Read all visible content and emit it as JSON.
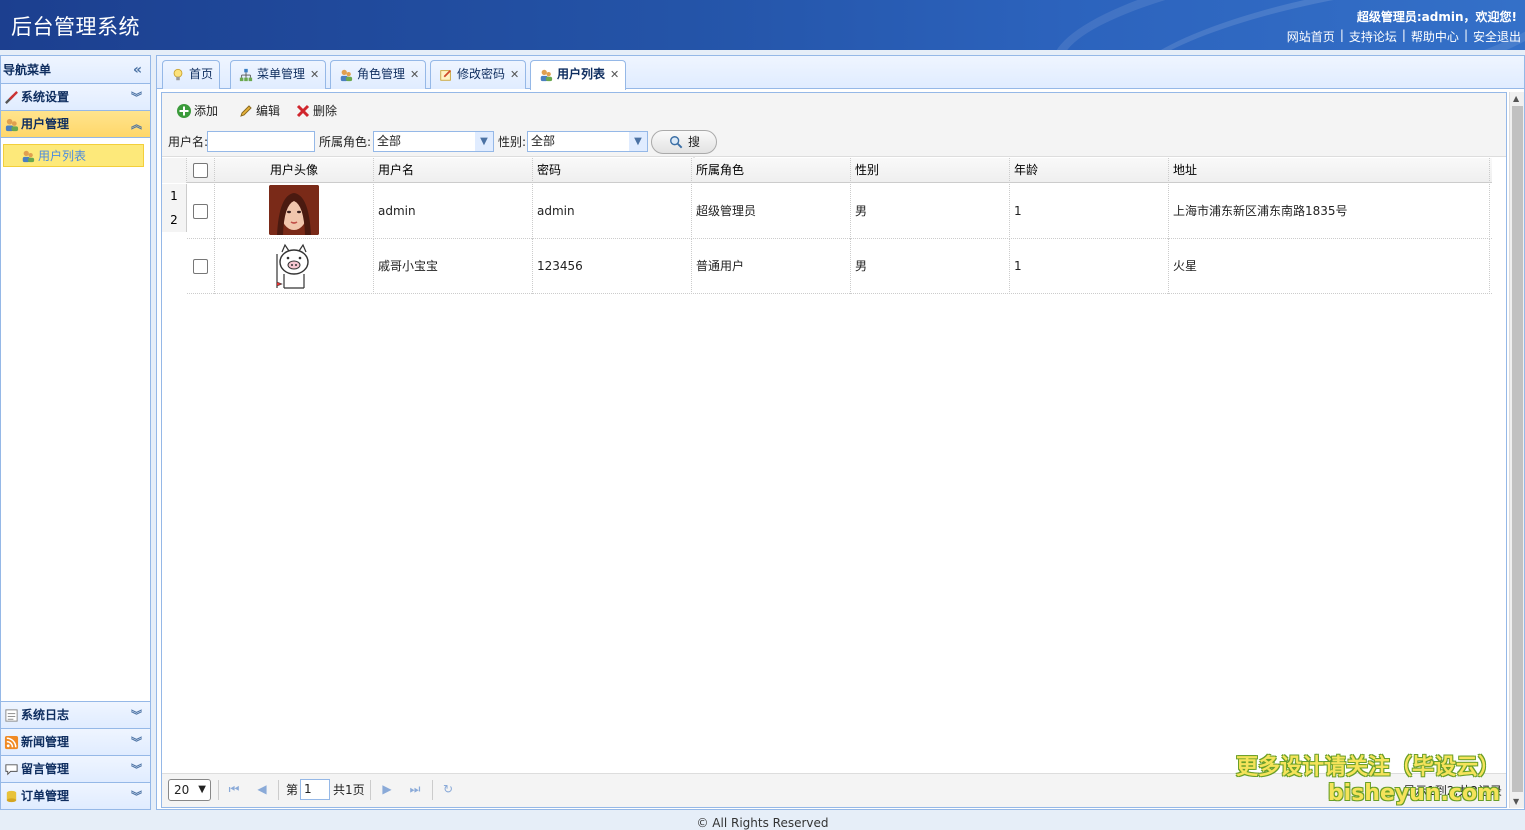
{
  "app": {
    "title": "后台管理系统",
    "welcome": "超级管理员:admin，欢迎您!",
    "links": [
      "网站首页",
      "支持论坛",
      "帮助中心",
      "安全退出"
    ]
  },
  "nav": {
    "header": "导航菜单",
    "panels": [
      {
        "label": "系统设置",
        "icon": "wrench-icon"
      },
      {
        "label": "用户管理",
        "icon": "users-icon"
      }
    ],
    "active_sub": "用户列表",
    "bottom_panels": [
      {
        "label": "系统日志",
        "icon": "log-icon"
      },
      {
        "label": "新闻管理",
        "icon": "rss-icon"
      },
      {
        "label": "留言管理",
        "icon": "comment-icon"
      },
      {
        "label": "订单管理",
        "icon": "database-icon"
      }
    ]
  },
  "tabs": [
    {
      "label": "首页",
      "closable": false
    },
    {
      "label": "菜单管理",
      "closable": true
    },
    {
      "label": "角色管理",
      "closable": true
    },
    {
      "label": "修改密码",
      "closable": true
    },
    {
      "label": "用户列表",
      "closable": true,
      "active": true
    }
  ],
  "toolbar": {
    "add": "添加",
    "edit": "编辑",
    "delete": "删除",
    "username_label": "用户名:",
    "username_value": "",
    "role_label": "所属角色:",
    "role_value": "全部",
    "gender_label": "性别:",
    "gender_value": "全部",
    "search": "搜索"
  },
  "grid": {
    "columns": [
      "用户头像",
      "用户名",
      "密码",
      "所属角色",
      "性别",
      "年龄",
      "地址"
    ],
    "rows": [
      {
        "num": "1",
        "avatar": "photo-avatar",
        "username": "admin",
        "password": "admin",
        "role": "超级管理员",
        "gender": "男",
        "age": "1",
        "address": "上海市浦东新区浦东南路1835号"
      },
      {
        "num": "2",
        "avatar": "pig-avatar",
        "username": "戚哥小宝宝",
        "password": "123456",
        "role": "普通用户",
        "gender": "男",
        "age": "1",
        "address": "火星"
      }
    ]
  },
  "pager": {
    "page_size": "20",
    "page_prefix": "第",
    "page_value": "1",
    "page_suffix": "共1页",
    "info": "显示1到2,共2记录"
  },
  "watermark": {
    "line1": "更多设计请关注（毕设云）",
    "line2": "bisheyun.com"
  },
  "footer": "© All Rights Reserved"
}
